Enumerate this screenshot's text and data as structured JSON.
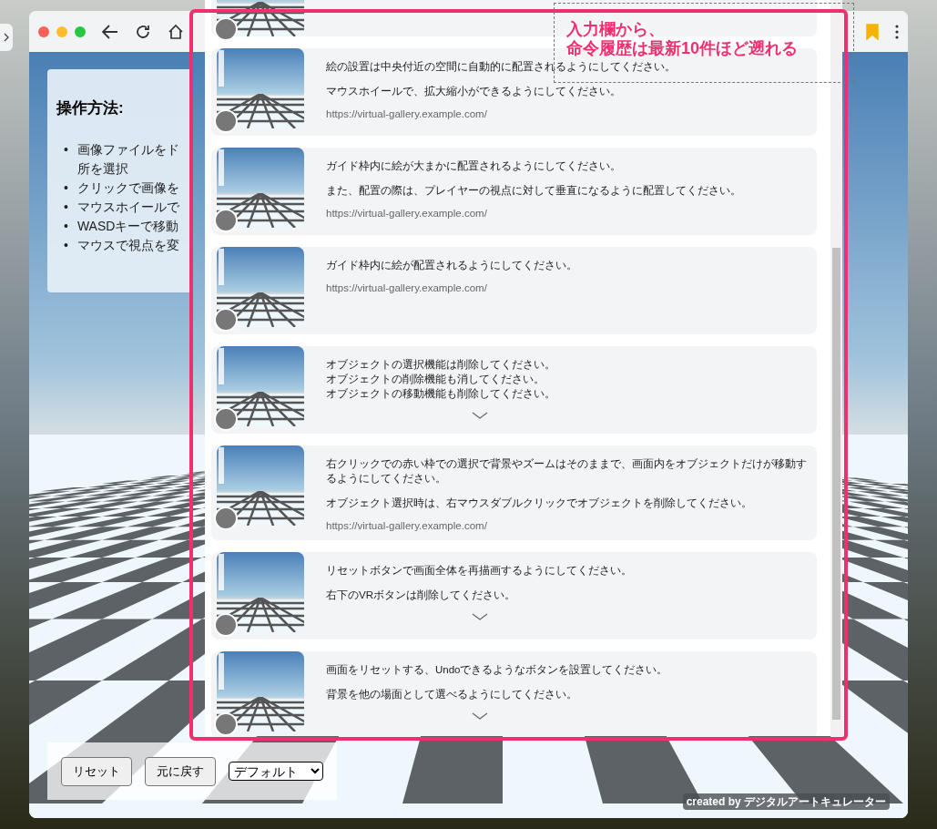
{
  "browser": {
    "bookmarked": true
  },
  "instructions": {
    "title": "操作方法:",
    "items": [
      {
        "marker": "•",
        "lines": [
          "画像ファイルをド",
          "所を選択"
        ]
      },
      {
        "marker": "•",
        "lines": [
          "クリックで画像を"
        ]
      },
      {
        "marker": "•",
        "lines": [
          "マウスホイールで"
        ]
      },
      {
        "marker": "•",
        "lines": [
          "WASDキーで移動"
        ]
      },
      {
        "marker": "•",
        "lines": [
          "マウスで視点を変"
        ]
      }
    ]
  },
  "controls": {
    "buttons": [
      "リセット",
      "元に戻す"
    ],
    "select": {
      "value": "デフォルト"
    }
  },
  "credit": "created by デジタルアートキュレーター",
  "history": [
    {
      "paragraphs": [
        "絵の設置は中央付近の空間に自動的に配置されるようにしてください。",
        "マウスホイールで、拡大縮小ができるようにしてください。"
      ],
      "link": "https://virtual-gallery.example.com/",
      "expandable": false
    },
    {
      "paragraphs": [
        "ガイド枠内に絵が大まかに配置されるようにしてください。",
        "また、配置の際は、プレイヤーの視点に対して垂直になるように配置してください。"
      ],
      "link": "https://virtual-gallery.example.com/",
      "expandable": false
    },
    {
      "paragraphs": [
        "ガイド枠内に絵が配置されるようにしてください。"
      ],
      "link": "https://virtual-gallery.example.com/",
      "expandable": false
    },
    {
      "paragraphs": [
        "オブジェクトの選択機能は削除してください。",
        "オブジェクトの削除機能も消してください。",
        "オブジェクトの移動機能も削除してください。"
      ],
      "paragraph_gap": false,
      "expandable": true
    },
    {
      "paragraphs": [
        "右クリックでの赤い枠での選択で背景やズームはそのままで、画面内をオブジェクトだけが移動するようにしてください。",
        "オブジェクト選択時は、右マウスダブルクリックでオブジェクトを削除してください。"
      ],
      "link": "https://virtual-gallery.example.com/",
      "expandable": false
    },
    {
      "paragraphs": [
        "リセットボタンで画面全体を再描画するようにしてください。",
        "右下のVRボタンは削除してください。"
      ],
      "expandable": true
    },
    {
      "paragraphs": [
        "画面をリセットする、Undoできるようなボタンを設置してください。",
        "背景を他の場面として選べるようにしてください。"
      ],
      "expandable": true
    }
  ],
  "annotation": {
    "lines": [
      "入力欄から、",
      "命令履歴は最新10件ほど遡れる"
    ]
  }
}
